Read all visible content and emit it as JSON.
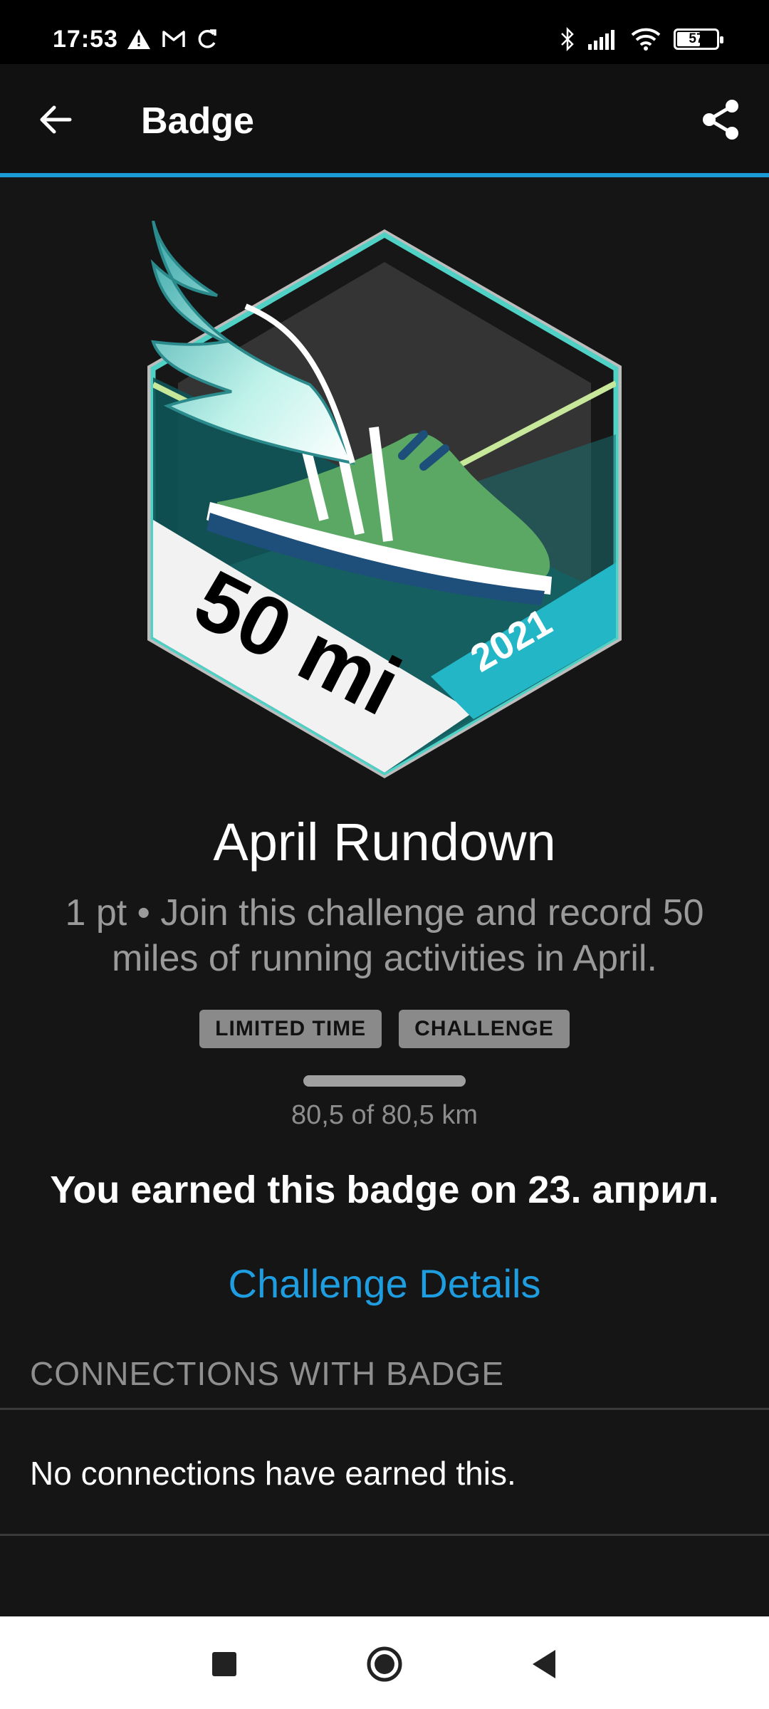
{
  "status_bar": {
    "time": "17:53",
    "battery": "57",
    "icons": [
      "warning-icon",
      "gmail-icon",
      "sync-icon",
      "bluetooth-icon",
      "signal-icon",
      "wifi-icon",
      "battery-icon"
    ]
  },
  "app_bar": {
    "title": "Badge",
    "back_icon": "arrow-left-icon",
    "share_icon": "share-icon"
  },
  "badge": {
    "label_distance": "50 mi",
    "label_year": "2021",
    "colors": {
      "teal": "#4fd1c5",
      "green": "#5aa863",
      "blue_ribbon": "#23b6c7"
    }
  },
  "title": "April Rundown",
  "description": "1 pt • Join this challenge and record 50 miles of running activities in April.",
  "tags": [
    "LIMITED TIME",
    "CHALLENGE"
  ],
  "progress": {
    "value": 1.0,
    "text": "80,5 of 80,5 km"
  },
  "earned_text": "You earned this badge on 23. април.",
  "challenge_link": "Challenge Details",
  "connections": {
    "header": "CONNECTIONS WITH BADGE",
    "empty_text": "No connections have earned this."
  },
  "nav": {
    "icons": [
      "recents-square-icon",
      "home-circle-icon",
      "back-triangle-icon"
    ]
  }
}
